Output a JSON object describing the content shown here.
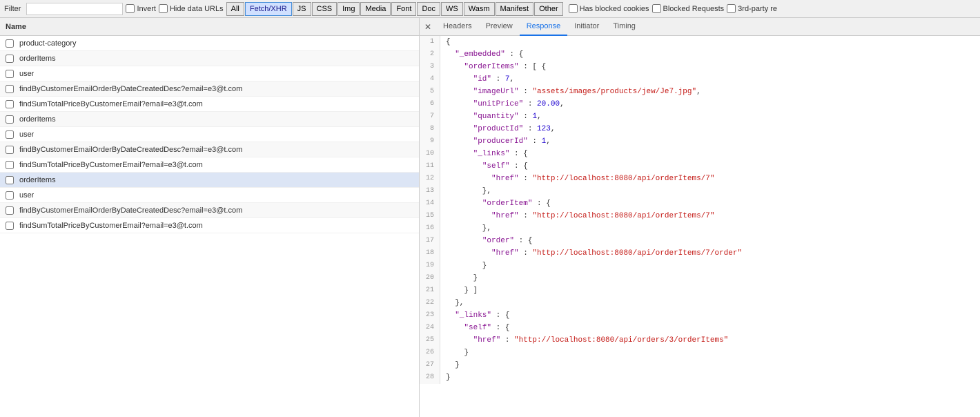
{
  "toolbar": {
    "filter_label": "Filter",
    "invert_label": "Invert",
    "hide_data_urls_label": "Hide data URLs",
    "filter_buttons": [
      "All",
      "Fetch/XHR",
      "JS",
      "CSS",
      "Img",
      "Media",
      "Font",
      "Doc",
      "WS",
      "Wasm",
      "Manifest",
      "Other"
    ],
    "active_filter": "Fetch/XHR",
    "has_blocked_cookies_label": "Has blocked cookies",
    "blocked_requests_label": "Blocked Requests",
    "third_party_label": "3rd-party re"
  },
  "left_panel": {
    "header_label": "Name",
    "requests": [
      {
        "id": 1,
        "name": "product-category",
        "selected": false
      },
      {
        "id": 2,
        "name": "orderItems",
        "selected": false
      },
      {
        "id": 3,
        "name": "user",
        "selected": false
      },
      {
        "id": 4,
        "name": "findByCustomerEmailOrderByDateCreatedDesc?email=e3@t.com",
        "selected": false
      },
      {
        "id": 5,
        "name": "findSumTotalPriceByCustomerEmail?email=e3@t.com",
        "selected": false
      },
      {
        "id": 6,
        "name": "orderItems",
        "selected": false
      },
      {
        "id": 7,
        "name": "user",
        "selected": false
      },
      {
        "id": 8,
        "name": "findByCustomerEmailOrderByDateCreatedDesc?email=e3@t.com",
        "selected": false
      },
      {
        "id": 9,
        "name": "findSumTotalPriceByCustomerEmail?email=e3@t.com",
        "selected": false
      },
      {
        "id": 10,
        "name": "orderItems",
        "selected": true
      },
      {
        "id": 11,
        "name": "user",
        "selected": false
      },
      {
        "id": 12,
        "name": "findByCustomerEmailOrderByDateCreatedDesc?email=e3@t.com",
        "selected": false
      },
      {
        "id": 13,
        "name": "findSumTotalPriceByCustomerEmail?email=e3@t.com",
        "selected": false
      }
    ]
  },
  "right_panel": {
    "tabs": [
      "Headers",
      "Preview",
      "Response",
      "Initiator",
      "Timing"
    ],
    "active_tab": "Response"
  },
  "response": {
    "lines": [
      {
        "num": 1,
        "content": "{"
      },
      {
        "num": 2,
        "content": "  \"_embedded\" : {"
      },
      {
        "num": 3,
        "content": "    \"orderItems\" : [ {"
      },
      {
        "num": 4,
        "content": "      \"id\" : 7,"
      },
      {
        "num": 5,
        "content": "      \"imageUrl\" : \"assets/images/products/jew/Je7.jpg\","
      },
      {
        "num": 6,
        "content": "      \"unitPrice\" : 20.00,"
      },
      {
        "num": 7,
        "content": "      \"quantity\" : 1,"
      },
      {
        "num": 8,
        "content": "      \"productId\" : 123,"
      },
      {
        "num": 9,
        "content": "      \"producerId\" : 1,"
      },
      {
        "num": 10,
        "content": "      \"_links\" : {"
      },
      {
        "num": 11,
        "content": "        \"self\" : {"
      },
      {
        "num": 12,
        "content": "          \"href\" : \"http://localhost:8080/api/orderItems/7\""
      },
      {
        "num": 13,
        "content": "        },"
      },
      {
        "num": 14,
        "content": "        \"orderItem\" : {"
      },
      {
        "num": 15,
        "content": "          \"href\" : \"http://localhost:8080/api/orderItems/7\""
      },
      {
        "num": 16,
        "content": "        },"
      },
      {
        "num": 17,
        "content": "        \"order\" : {"
      },
      {
        "num": 18,
        "content": "          \"href\" : \"http://localhost:8080/api/orderItems/7/order\""
      },
      {
        "num": 19,
        "content": "        }"
      },
      {
        "num": 20,
        "content": "      }"
      },
      {
        "num": 21,
        "content": "    } ]"
      },
      {
        "num": 22,
        "content": "  },"
      },
      {
        "num": 23,
        "content": "  \"_links\" : {"
      },
      {
        "num": 24,
        "content": "    \"self\" : {"
      },
      {
        "num": 25,
        "content": "      \"href\" : \"http://localhost:8080/api/orders/3/orderItems\""
      },
      {
        "num": 26,
        "content": "    }"
      },
      {
        "num": 27,
        "content": "  }"
      },
      {
        "num": 28,
        "content": "}"
      }
    ]
  }
}
